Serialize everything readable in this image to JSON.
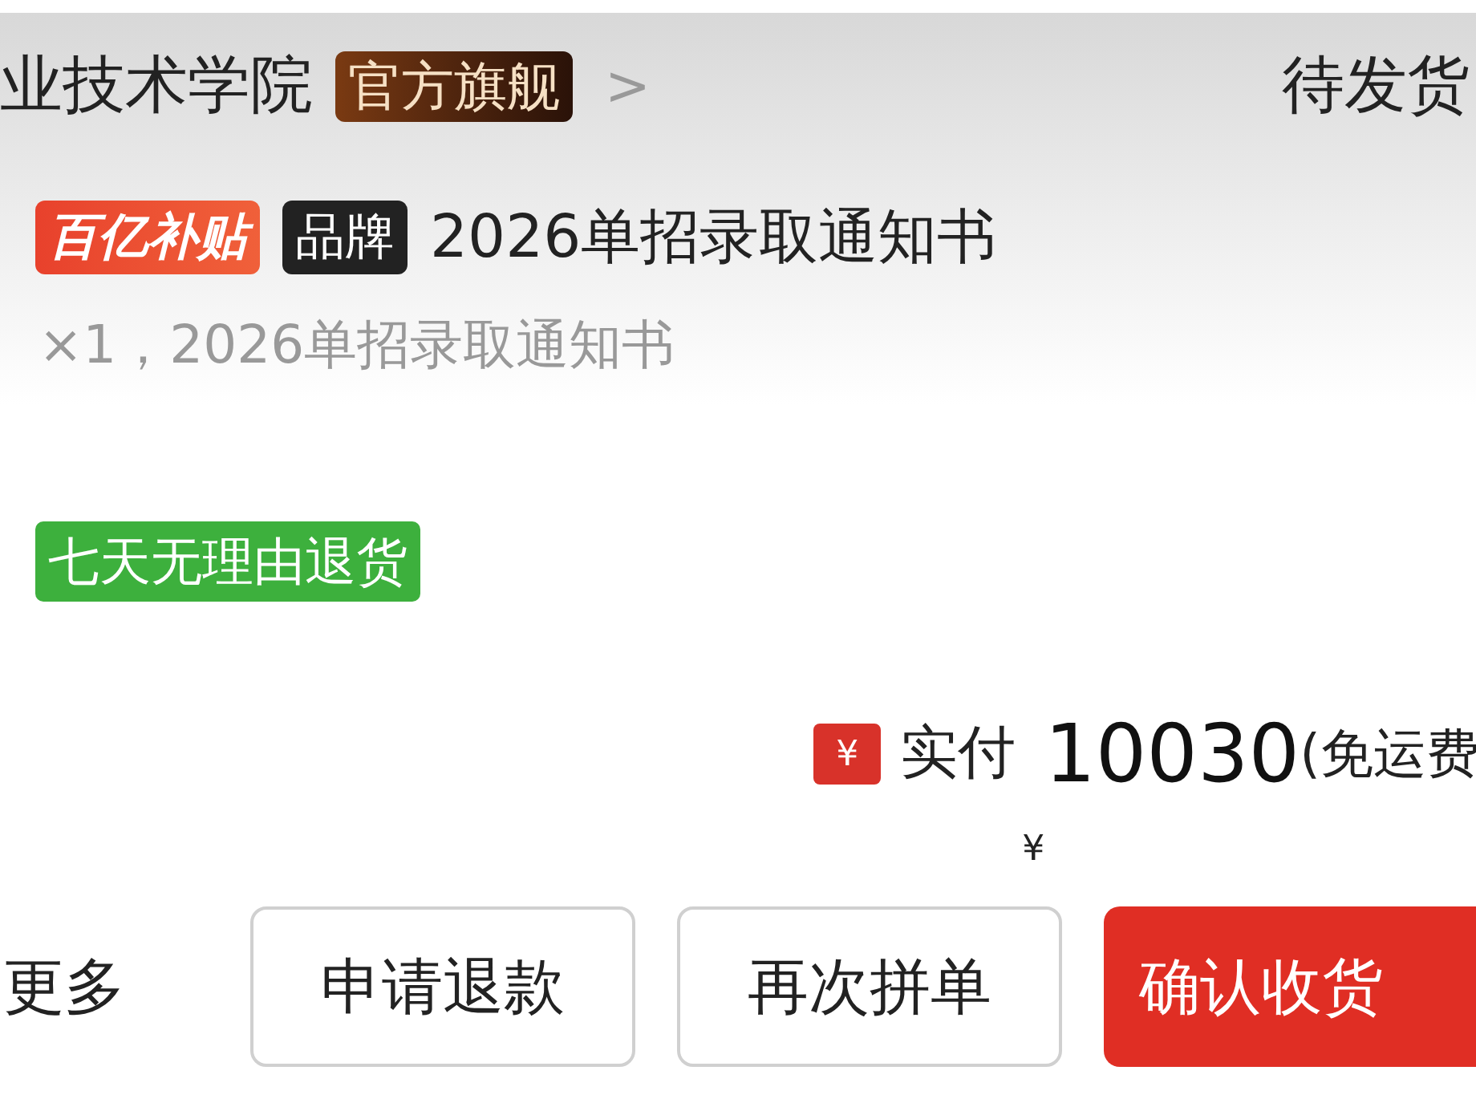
{
  "shop": {
    "name": "业技术学院",
    "badge": "官方旗舰",
    "chevron": ">"
  },
  "order_status": "待发货",
  "product": {
    "tags": [
      {
        "kind": "subsidy",
        "label": "百亿补贴"
      },
      {
        "kind": "brand",
        "label": "品牌"
      }
    ],
    "title": "2026单招录取通知书",
    "spec": "×1，2026单招录取通知书",
    "service_tag": "七天无理由退货"
  },
  "payment": {
    "icon": "¥",
    "label": "实付",
    "currency": "¥",
    "amount": "10030",
    "note": "(免运费"
  },
  "actions": [
    {
      "kind": "link",
      "label": "更多"
    },
    {
      "kind": "outline",
      "label": "申请退款"
    },
    {
      "kind": "outline",
      "label": "再次拼单"
    },
    {
      "kind": "primary",
      "label": "确认收货"
    }
  ]
}
